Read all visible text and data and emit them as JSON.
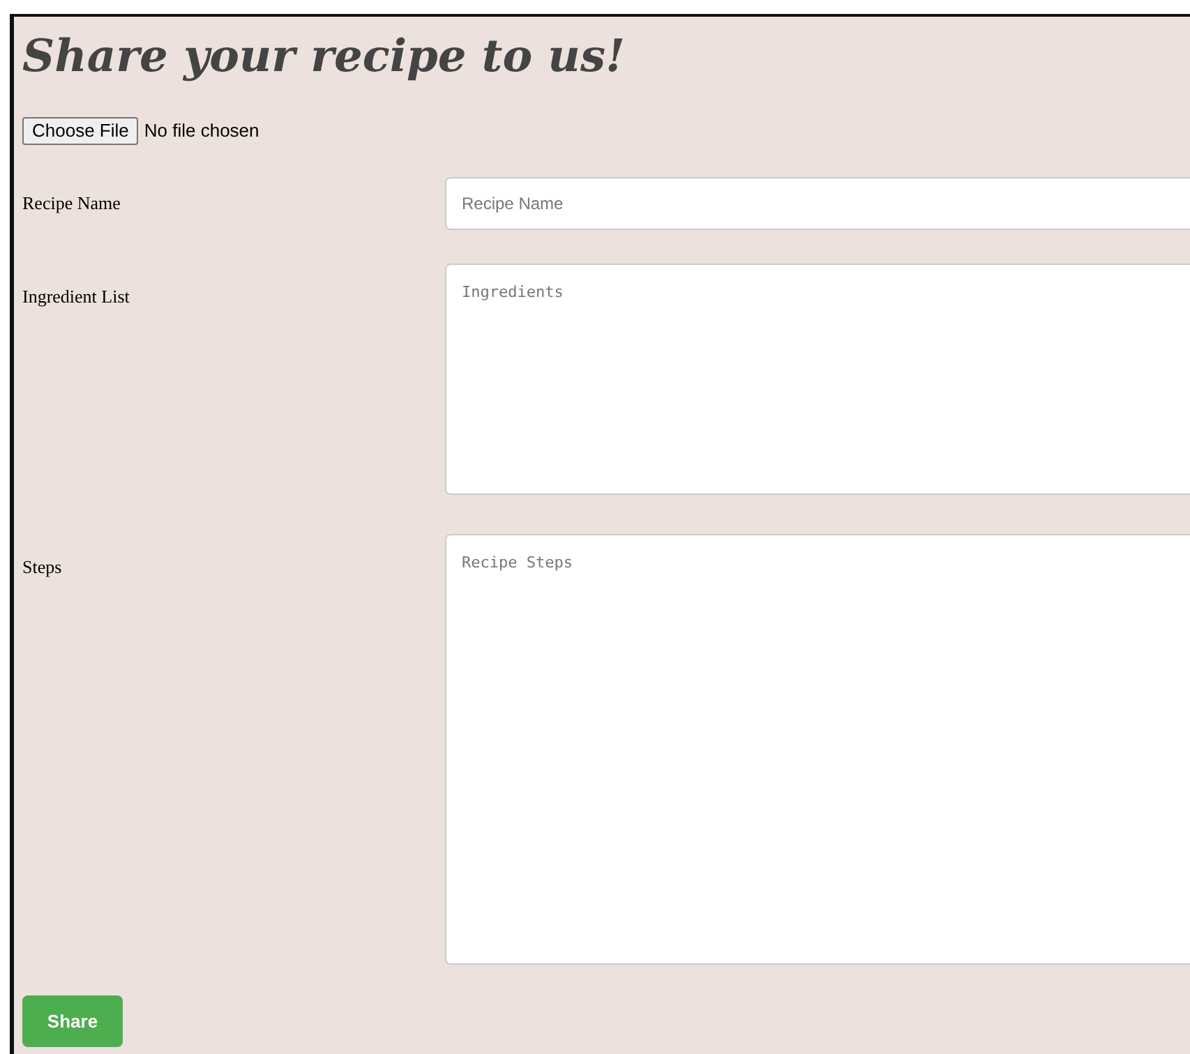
{
  "title": "Share your recipe to us!",
  "file_picker": {
    "button": "Choose File",
    "status": "No file chosen"
  },
  "fields": [
    {
      "label": "Recipe Name",
      "kind": "input",
      "placeholder": "Recipe Name"
    },
    {
      "label": "Ingredient List",
      "kind": "textarea",
      "placeholder": "Ingredients"
    },
    {
      "label": "Steps",
      "kind": "textarea",
      "placeholder": "Recipe Steps"
    }
  ],
  "submit": "Share"
}
